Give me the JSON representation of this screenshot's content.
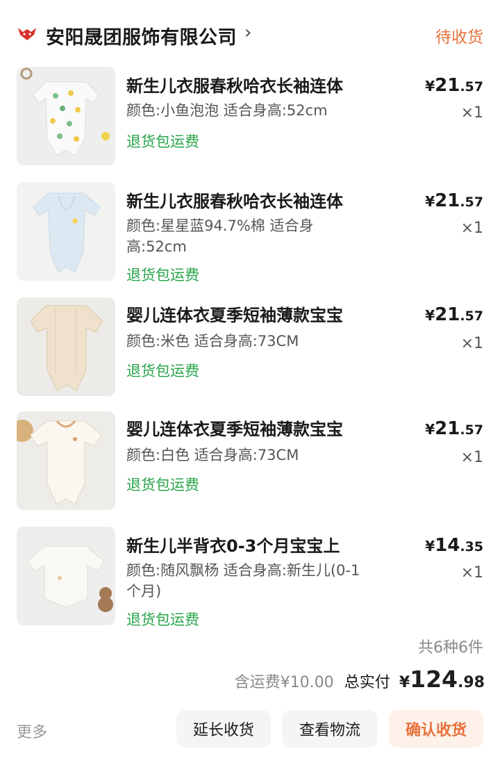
{
  "order": {
    "shop_name": "安阳晟团服饰有限公司",
    "shop_icon": "shop-logo-icon",
    "status": "待收货",
    "accent_color": "#e8713a",
    "badge_color": "#27a449"
  },
  "items": [
    {
      "title": "新生儿衣服春秋哈衣长袖连体",
      "spec": "颜色:小鱼泡泡 适合身高:52cm",
      "badge": "退货包运费",
      "price_currency": "¥",
      "price_int": "21",
      "price_dec": ".57",
      "qty": "×1"
    },
    {
      "title": "新生儿衣服春秋哈衣长袖连体",
      "spec": "颜色:星星蓝94.7%棉 适合身高:52cm",
      "badge": "退货包运费",
      "price_currency": "¥",
      "price_int": "21",
      "price_dec": ".57",
      "qty": "×1"
    },
    {
      "title": "婴儿连体衣夏季短袖薄款宝宝",
      "spec": "颜色:米色 适合身高:73CM",
      "badge": "退货包运费",
      "price_currency": "¥",
      "price_int": "21",
      "price_dec": ".57",
      "qty": "×1"
    },
    {
      "title": "婴儿连体衣夏季短袖薄款宝宝",
      "spec": "颜色:白色 适合身高:73CM",
      "badge": "退货包运费",
      "price_currency": "¥",
      "price_int": "21",
      "price_dec": ".57",
      "qty": "×1"
    },
    {
      "title": "新生儿半背衣0-3个月宝宝上",
      "spec": "颜色:随风飘杨 适合身高:新生儿(0-1个月)",
      "badge": "退货包运费",
      "price_currency": "¥",
      "price_int": "14",
      "price_dec": ".35",
      "qty": "×1"
    }
  ],
  "summary": {
    "count": "共6种6件",
    "shipping": "含运费¥10.00",
    "total_label": "总实付",
    "total_currency": "¥",
    "total_int": "124",
    "total_dec": ".98"
  },
  "actions": {
    "more": "更多",
    "extend": "延长收货",
    "logistics": "查看物流",
    "confirm": "确认收货"
  }
}
